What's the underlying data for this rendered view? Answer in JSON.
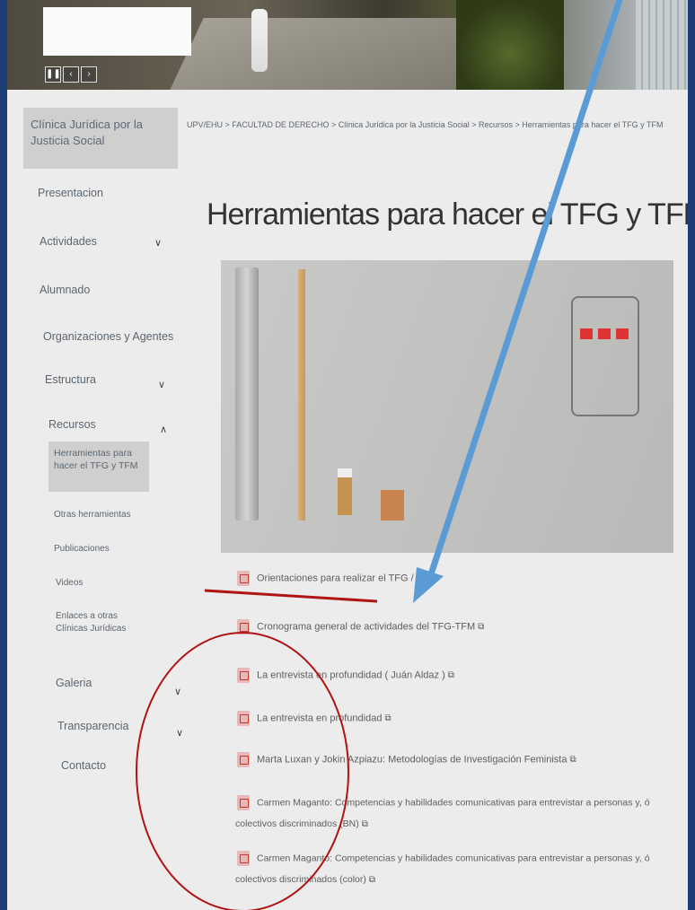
{
  "banner": {
    "pause": "❚❚",
    "prev": "‹",
    "next": "›"
  },
  "sidebar": {
    "title": "Clínica Jurídica por la Justicia Social",
    "items": [
      {
        "label": "Presentacion"
      },
      {
        "label": "Actividades",
        "chevron": "∨"
      },
      {
        "label": "Alumnado"
      },
      {
        "label": "Organizaciones y Agentes"
      },
      {
        "label": "Estructura",
        "chevron": "∨"
      },
      {
        "label": "Recursos",
        "chevron": "∧"
      }
    ],
    "active": "Herramientas para hacer el TFG y TFM",
    "subitems": [
      {
        "label": "Otras herramientas"
      },
      {
        "label": "Publicaciones"
      },
      {
        "label": "Videos"
      },
      {
        "label": "Enlaces a otras Clínicas Jurídicas"
      }
    ],
    "bottom": [
      {
        "label": "Galeria",
        "chevron": "∨"
      },
      {
        "label": "Transparencia",
        "chevron": "∨"
      },
      {
        "label": "Contacto"
      }
    ]
  },
  "breadcrumb": "UPV/EHU > FACULTAD DE DERECHO > Clínica Jurídica por la Justicia Social > Recursos > Herramientas para hacer el TFG y TFM",
  "page_title": "Herramientas para hacer el TFG y TFM",
  "links": [
    {
      "label": "Orientaciones para realizar el TFG / TFM"
    },
    {
      "label": "Cronograma general de actividades del TFG-TFM",
      "ext": "⧉"
    },
    {
      "label": "La entrevista en profundidad ( Juán Aldaz )",
      "ext": "⧉"
    },
    {
      "label": "La entrevista en profundidad",
      "ext": "⧉"
    },
    {
      "label": "Marta Luxan y Jokin Azpiazu: Metodologías de Investigación Feminista",
      "ext": "⧉"
    },
    {
      "label": "Carmen Maganto: Competencias y habilidades comunicativas para entrevistar a personas y, ó",
      "cont": "colectivos discriminados (BN)",
      "ext": "⧉"
    },
    {
      "label": "Carmen Maganto: Competencias y habilidades comunicativas para entrevistar a personas y, ó",
      "cont": "colectivos discriminados (color)",
      "ext": "⧉"
    }
  ],
  "annotation_colors": {
    "arrow": "#5b9bd5",
    "underline": "#b01515",
    "circle": "#b01515"
  }
}
